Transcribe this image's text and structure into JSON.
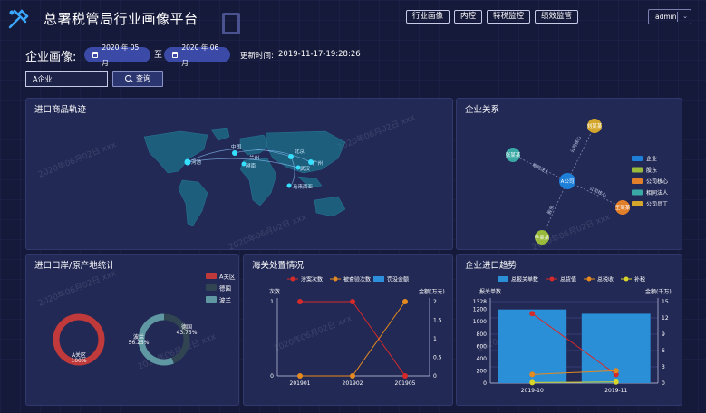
{
  "header": {
    "app_title": "总署税管局行业画像平台",
    "nav": [
      "行业画像",
      "内控",
      "特税监控",
      "绩效监管"
    ],
    "user": "admin"
  },
  "filter": {
    "label": "企业画像:",
    "date_start": "2020 年 05 月",
    "date_sep": "至",
    "date_end": "2020 年 06 月",
    "update_label": "更新时间:",
    "update_time": "2019-11-17-19:28:26",
    "company_value": "A企业",
    "query_label": "查询"
  },
  "watermark": "2020年06月02日 xxx",
  "trajectory": {
    "title": "进口商品轨迹",
    "cities": [
      "河池",
      "马来西亚",
      "中国",
      "北京",
      "武汉",
      "兰州",
      "广州",
      "越南"
    ]
  },
  "relation": {
    "title": "企业关系",
    "center": "A公司",
    "nodes": [
      "张某某",
      "刘某某",
      "王某某",
      "李某某",
      "张某某"
    ],
    "edges": [
      "相同法人",
      "公司核心",
      "公司核心",
      "股东",
      "公司员工"
    ],
    "legend": [
      {
        "label": "企业",
        "color": "#1e7fd9"
      },
      {
        "label": "股东",
        "color": "#9aba3c"
      },
      {
        "label": "公司核心",
        "color": "#e27f2a"
      },
      {
        "label": "相同法人",
        "color": "#3aa9a6"
      },
      {
        "label": "公司员工",
        "color": "#d4a72c"
      }
    ]
  },
  "chart_data": [
    {
      "type": "pie",
      "title": "进口口岸/原产地统计",
      "legend": [
        "A关区",
        "德国",
        "波兰"
      ],
      "colors": [
        "#c0393b",
        "#314452",
        "#5f97a2"
      ],
      "rings": [
        {
          "slices": [
            {
              "label": "A关区",
              "value": 100,
              "text": "100%"
            }
          ]
        },
        {
          "slices": [
            {
              "label": "德国",
              "value": 43.75,
              "text": "43.75%"
            },
            {
              "label": "波兰",
              "value": 56.25,
              "text": "56.25%"
            }
          ]
        }
      ]
    },
    {
      "type": "line",
      "title": "海关处置情况",
      "legend": [
        "涉案次数",
        "被查验次数",
        "罚没金额"
      ],
      "categories": [
        "201901",
        "201902",
        "201905"
      ],
      "ylabel_left": "次数",
      "ylabel_right": "金额(万元)",
      "ylim_left": [
        0,
        1
      ],
      "ylim_right": [
        0,
        2
      ],
      "left_ticks": [
        "0",
        "1"
      ],
      "right_ticks": [
        "0",
        "0.5",
        "1",
        "1.5",
        "2"
      ],
      "series": [
        {
          "name": "涉案次数",
          "axis": "left",
          "color": "#d42a2a",
          "values": [
            1,
            1,
            0
          ]
        },
        {
          "name": "被查验次数",
          "axis": "right",
          "color": "#e58a1f",
          "values": [
            0,
            0,
            2
          ]
        },
        {
          "name": "罚没金额",
          "axis": "left",
          "color": "#2d8fdc",
          "values": [
            0,
            0,
            0
          ]
        }
      ]
    },
    {
      "type": "bar",
      "title": "企业进口趋势",
      "legend": [
        "总报关单数",
        "总货值",
        "总税收",
        "补税"
      ],
      "categories": [
        "2019-10",
        "2019-11"
      ],
      "ylabel_left": "报关单数",
      "ylabel_right": "金额(千万)",
      "ylim_left": [
        0,
        1328
      ],
      "ylim_right": [
        0,
        15
      ],
      "left_ticks": [
        "0",
        "200",
        "400",
        "600",
        "800",
        "1000",
        "1200",
        "1328"
      ],
      "right_ticks": [
        "0",
        "3",
        "6",
        "9",
        "12",
        "15"
      ],
      "series": [
        {
          "name": "总报关单数",
          "type": "bar",
          "axis": "left",
          "color": "#2a8fd6",
          "values": [
            1200,
            1130
          ]
        },
        {
          "name": "总货值",
          "type": "line",
          "axis": "right",
          "color": "#d42a2a",
          "values": [
            12.8,
            1.6
          ]
        },
        {
          "name": "总税收",
          "type": "line",
          "axis": "right",
          "color": "#e58a1f",
          "values": [
            1.6,
            2.3
          ]
        },
        {
          "name": "补税",
          "type": "line",
          "axis": "right",
          "color": "#d8d42a",
          "values": [
            0.1,
            0.2
          ]
        }
      ]
    }
  ]
}
